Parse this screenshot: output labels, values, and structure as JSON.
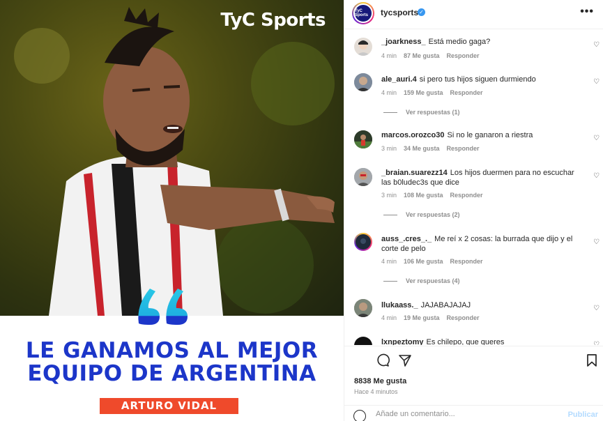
{
  "post": {
    "brand_logo": "TyC Sports",
    "headline_line1": "LE GANAMOS AL MEJOR",
    "headline_line2": "EQUIPO DE ARGENTINA",
    "name_tag": "ARTURO VIDAL"
  },
  "header": {
    "avatar_text": "TyC Sports",
    "username": "tycsports",
    "verified": "✓",
    "more": "•••"
  },
  "comments": [
    {
      "user": "_joarkness_",
      "text": "Está medio gaga?",
      "time": "4 min",
      "likes": "87 Me gusta",
      "reply": "Responder"
    },
    {
      "user": "ale_auri.4",
      "text": "si pero tus hijos siguen durmiendo",
      "time": "4 min",
      "likes": "159 Me gusta",
      "reply": "Responder",
      "replies": "Ver respuestas (1)"
    },
    {
      "user": "marcos.orozco30",
      "text": "Si no le ganaron a riestra",
      "time": "3 min",
      "likes": "34 Me gusta",
      "reply": "Responder"
    },
    {
      "user": "_braian.suarezz14",
      "text": "Los hijos duermen para no escuchar las b0ludec3s que dice",
      "time": "3 min",
      "likes": "108 Me gusta",
      "reply": "Responder",
      "replies": "Ver respuestas (2)"
    },
    {
      "user": "auss_.cres_._",
      "text": "Me reí x 2 cosas: la burrada que dijo y el corte de pelo",
      "time": "4 min",
      "likes": "106 Me gusta",
      "reply": "Responder",
      "replies": "Ver respuestas (4)"
    },
    {
      "user": "llukaass._",
      "text": "JAJABAJAJAJ",
      "time": "4 min",
      "likes": "19 Me gusta",
      "reply": "Responder"
    },
    {
      "user": "lxnpeztomy",
      "text": "Es chilepo, que queres"
    }
  ],
  "footer": {
    "likes": "8838 Me gusta",
    "time_ago": "Hace 4 minutos",
    "input_placeholder": "Añade un comentario...",
    "post_label": "Publicar"
  }
}
